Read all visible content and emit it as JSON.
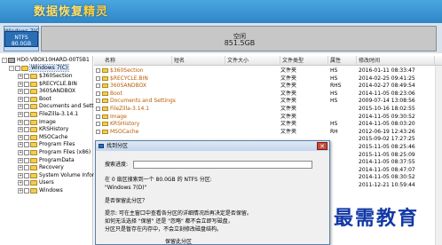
{
  "app": {
    "title_plain": "数据恢复",
    "title_highlight": "精灵"
  },
  "disk": {
    "partition_c": {
      "label": "Windows 7(C",
      "fs": "NTFS",
      "size": "80.0GB"
    },
    "free": {
      "label": "空闲",
      "size": "851.5GB"
    }
  },
  "tree": {
    "drive": "HD0:VBOX10HARD-00T5B1",
    "root": "Windows 7(C)",
    "items": [
      "$360Section",
      "$RECYCLE.BIN",
      "360SANDBOX",
      "Boot",
      "Documents and Settings",
      "FileZilla-3.14.1",
      "Image",
      "KRSHistory",
      "MSOCache",
      "Program Files",
      "Program Files (x86)",
      "ProgramData",
      "Recovery",
      "System Volume Infor",
      "Users",
      "Windows"
    ]
  },
  "list": {
    "headers": {
      "name": "名称",
      "short": "短名",
      "size": "文件大小",
      "type": "文件类型",
      "attr": "属性",
      "modified": "修改时间"
    },
    "rows": [
      {
        "name": "$360Section",
        "type": "文件夹",
        "attr": "HS",
        "modified": "2016-01-11 08:33:47"
      },
      {
        "name": "$RECYCLE.BIN",
        "type": "文件夹",
        "attr": "HS",
        "modified": "2014-02-25 09:41:25"
      },
      {
        "name": "360SANDBOX",
        "type": "文件夹",
        "attr": "RHS",
        "modified": "2014-02-27 08:49:54"
      },
      {
        "name": "Boot",
        "type": "文件夹",
        "attr": "HS",
        "modified": "2014-11-05 08:23:06"
      },
      {
        "name": "Documents and Settings",
        "type": "文件夹",
        "attr": "HS",
        "modified": "2009-07-14 13:08:56"
      },
      {
        "name": "FileZilla-3.14.1",
        "type": "文件夹",
        "attr": "",
        "modified": "2015-10-16 18:02:55"
      },
      {
        "name": "Image",
        "type": "文件夹",
        "attr": "",
        "modified": "2014-11-05 09:30:52"
      },
      {
        "name": "KRSHistory",
        "type": "文件夹",
        "attr": "HS",
        "modified": "2014-11-05 08:03:20"
      },
      {
        "name": "MSOCache",
        "type": "文件夹",
        "attr": "RH",
        "modified": "2012-06-19 12:43:26"
      },
      {
        "name": "",
        "type": "",
        "attr": "",
        "modified": "2015-09-02 17:27:25"
      },
      {
        "name": "",
        "type": "",
        "attr": "",
        "modified": "2015-11-05 08:25:46"
      },
      {
        "name": "",
        "type": "",
        "attr": "",
        "modified": "2015-11-05 08:25:09"
      },
      {
        "name": "",
        "type": "",
        "attr": "",
        "modified": "2014-11-05 08:37:55"
      },
      {
        "name": "",
        "type": "",
        "attr": "",
        "modified": "2014-11-05 08:47:07"
      },
      {
        "name": "",
        "type": "",
        "attr": "",
        "modified": "2014-11-05 08:30:52"
      },
      {
        "name": "",
        "type": "",
        "attr": "",
        "modified": "2011-12-21 10:59:44"
      }
    ]
  },
  "dialog": {
    "title": "找到分区",
    "progress_label": "搜索进度:",
    "progress_value": 0,
    "found_line_1": "在 0 扇区搜索到一个 80.0GB 的 NTFS 分区:",
    "found_line_2": "\"Windows 7(D)\"",
    "question": "是否保留此分区？",
    "tip_1": "提示: 可在主窗口中查看各分区的详细情况后再决定是否保留。",
    "tip_2": "如何无法选择 \"保留\" 还是 \"忽略\" 都不会立即写磁盘，",
    "tip_3": "分区只是暂存在内存中，不会立刻修改磁盘结构。",
    "ok_label": "保留此分区"
  },
  "watermark": "最需教育",
  "colors": {
    "banner": "#2f85c6",
    "accent": "#2a6fb5",
    "free_partition": "#c7c7c7"
  }
}
